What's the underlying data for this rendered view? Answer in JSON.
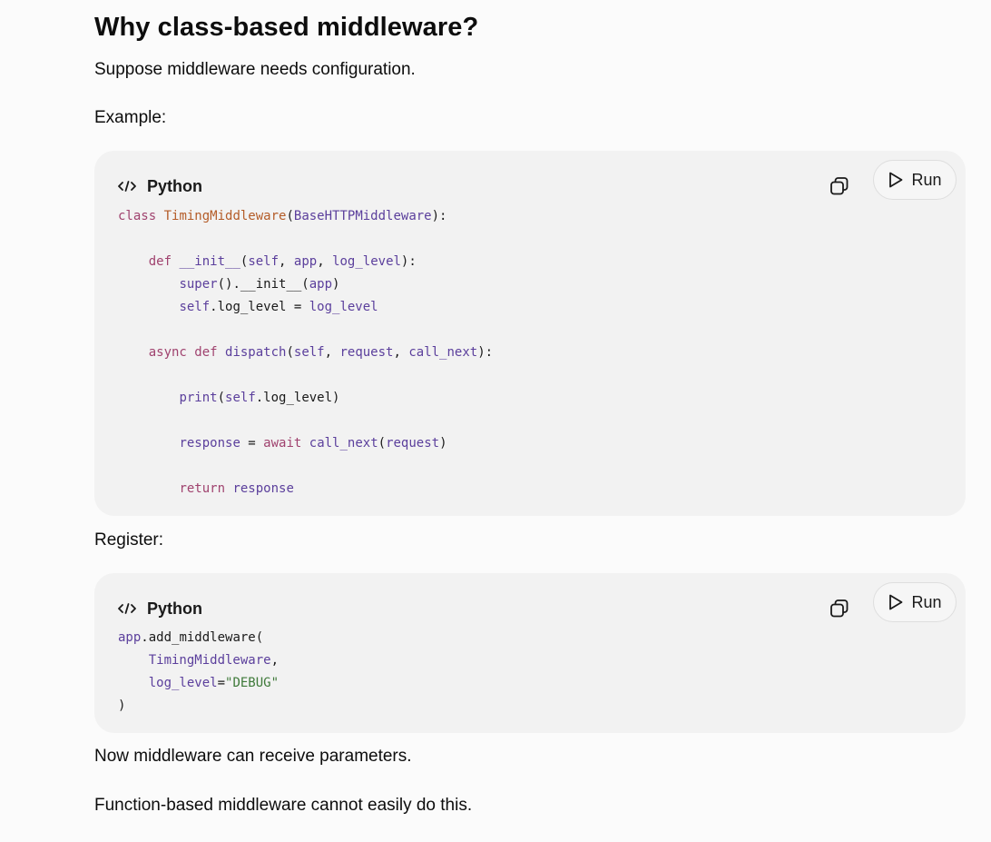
{
  "heading": "Why class-based middleware?",
  "intro": "Suppose middleware needs configuration.",
  "example_label": "Example:",
  "register_label": "Register:",
  "outro1": "Now middleware can receive parameters.",
  "outro2": "Function-based middleware cannot easily do this.",
  "code_blocks": [
    {
      "language": "Python",
      "run_label": "Run",
      "lines": [
        "class TimingMiddleware(BaseHTTPMiddleware):",
        "",
        "    def __init__(self, app, log_level):",
        "        super().__init__(app)",
        "        self.log_level = log_level",
        "",
        "    async def dispatch(self, request, call_next):",
        "",
        "        print(self.log_level)",
        "",
        "        response = await call_next(request)",
        "",
        "        return response"
      ]
    },
    {
      "language": "Python",
      "run_label": "Run",
      "lines": [
        "app.add_middleware(",
        "    TimingMiddleware,",
        "    log_level=\"DEBUG\"",
        ")"
      ]
    }
  ],
  "icons": {
    "lang": "code-icon",
    "copy": "copy-icon",
    "run": "play-icon"
  },
  "colors": {
    "background": "#fbfbfb",
    "code_background": "#f2f2f2",
    "keyword": "#a0436f",
    "class_name": "#b45c28",
    "identifier": "#5b3f9c",
    "string": "#3f7a3a"
  }
}
